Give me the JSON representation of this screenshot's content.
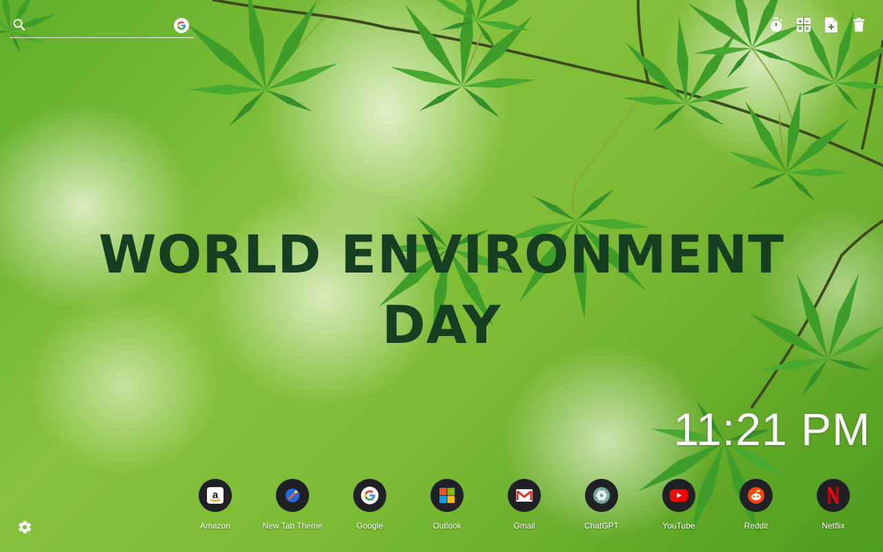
{
  "search": {
    "value": "",
    "placeholder": ""
  },
  "toolbar": {
    "icons": [
      "timer-icon",
      "calculator-icon",
      "new-note-icon",
      "trash-icon"
    ]
  },
  "headline": {
    "line1": "WORLD ENVIRONMENT",
    "line2": "DAY"
  },
  "clock": {
    "time": "11:21 PM"
  },
  "shortcuts": [
    {
      "label": "Amazon",
      "icon": "amazon-icon"
    },
    {
      "label": "New Tab Theme",
      "icon": "new-tab-theme-icon"
    },
    {
      "label": "Google",
      "icon": "google-icon"
    },
    {
      "label": "Outlook",
      "icon": "outlook-icon"
    },
    {
      "label": "Gmail",
      "icon": "gmail-icon"
    },
    {
      "label": "ChatGPT",
      "icon": "chatgpt-icon"
    },
    {
      "label": "YouTube",
      "icon": "youtube-icon"
    },
    {
      "label": "Reddit",
      "icon": "reddit-icon"
    },
    {
      "label": "Netflix",
      "icon": "netflix-icon"
    }
  ],
  "colors": {
    "headline": "#163e21",
    "shortcut_bg": "#202124",
    "background_green": "#7cbb34"
  }
}
